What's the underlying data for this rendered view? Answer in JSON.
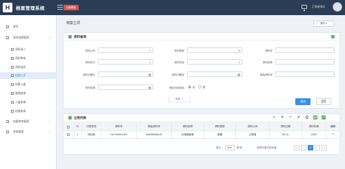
{
  "header": {
    "logo_letter": "H",
    "app_title": "档案管理系统",
    "switch_label": "切换模板",
    "user_name": "汇联者测试"
  },
  "sidebar": {
    "items": [
      {
        "label": "首页",
        "icon": "home-icon"
      },
      {
        "label": "综合档案管理",
        "icon": "folder-icon",
        "arrow": "∨"
      },
      {
        "label": "资料录入",
        "icon": "edit-icon"
      },
      {
        "label": "资料审核",
        "icon": "check-icon"
      },
      {
        "label": "资料修改",
        "icon": "edit-icon"
      },
      {
        "label": "档案立项",
        "icon": "file-icon"
      },
      {
        "label": "档案入盒",
        "icon": "box-icon"
      },
      {
        "label": "整理查询",
        "icon": "list-icon"
      },
      {
        "label": "入盒查询",
        "icon": "search-icon"
      },
      {
        "label": "档案查询",
        "icon": "search-icon"
      },
      {
        "label": "档案库房管理",
        "icon": "warehouse-icon",
        "arrow": "<"
      },
      {
        "label": "系统管理",
        "icon": "gear-icon",
        "arrow": "<"
      }
    ]
  },
  "page": {
    "title": "档案立项",
    "more_label": "操作 ▾"
  },
  "search": {
    "panel_title": "资料查询",
    "collapse_symbol": "−",
    "fields": [
      {
        "label": "资料公司",
        "value": "",
        "icon": "search-icon"
      },
      {
        "label": "资料类型",
        "value": "",
        "icon": "chevron-down-icon"
      },
      {
        "label": "资料号",
        "value": "",
        "icon": ""
      },
      {
        "label": "资料号头",
        "value": "",
        "icon": "search-icon"
      },
      {
        "label": "资料号至",
        "value": "",
        "icon": "search-icon"
      },
      {
        "label": "资料名称",
        "value": "",
        "icon": ""
      },
      {
        "label": "资料日期从",
        "value": "",
        "icon": "calendar-icon"
      },
      {
        "label": "资料日期至",
        "value": "",
        "icon": "calendar-icon"
      },
      {
        "label": "原始资料号",
        "value": "",
        "icon": ""
      },
      {
        "label": "资料年度",
        "value": "",
        "icon": "calendar-icon"
      }
    ],
    "filed_label": "是否归档添加",
    "filed_no": "否",
    "filed_yes": "是",
    "collapse_link": "收起 ∧",
    "query_button": "查询",
    "reset_button": "重置"
  },
  "list": {
    "panel_title": "立卷列表",
    "toolbar_icons": [
      "add-icon",
      "delete-icon",
      "approve-icon",
      "confirm-icon",
      "print-icon",
      "export-icon",
      "expand-icon"
    ],
    "columns": [
      "",
      "行",
      "归档状态",
      "资料号",
      "原始资料号",
      "资料名称",
      "资料类型",
      "资料公司",
      "资料日期",
      "资料年度",
      "编辑"
    ],
    "rows": [
      {
        "row": "1",
        "status": "待归档",
        "doc_no": "HLY100012911",
        "orig_no": "EM200008100",
        "name": "日常报销单",
        "type": "单据",
        "company": "汇联易",
        "date": "06-12",
        "year": "2020"
      }
    ]
  },
  "pager": {
    "display_label": "显示",
    "page_size": "10 ▾",
    "rows_label": "条/页",
    "no_records": "没有可显示的记录。",
    "first": "«",
    "prev": "‹",
    "current": "0",
    "next": "›",
    "last": "»"
  },
  "colors": {
    "header_bg": "#2b3d54",
    "accent": "#3a8ee6",
    "danger": "#d9534f",
    "success": "#5cb85c"
  }
}
